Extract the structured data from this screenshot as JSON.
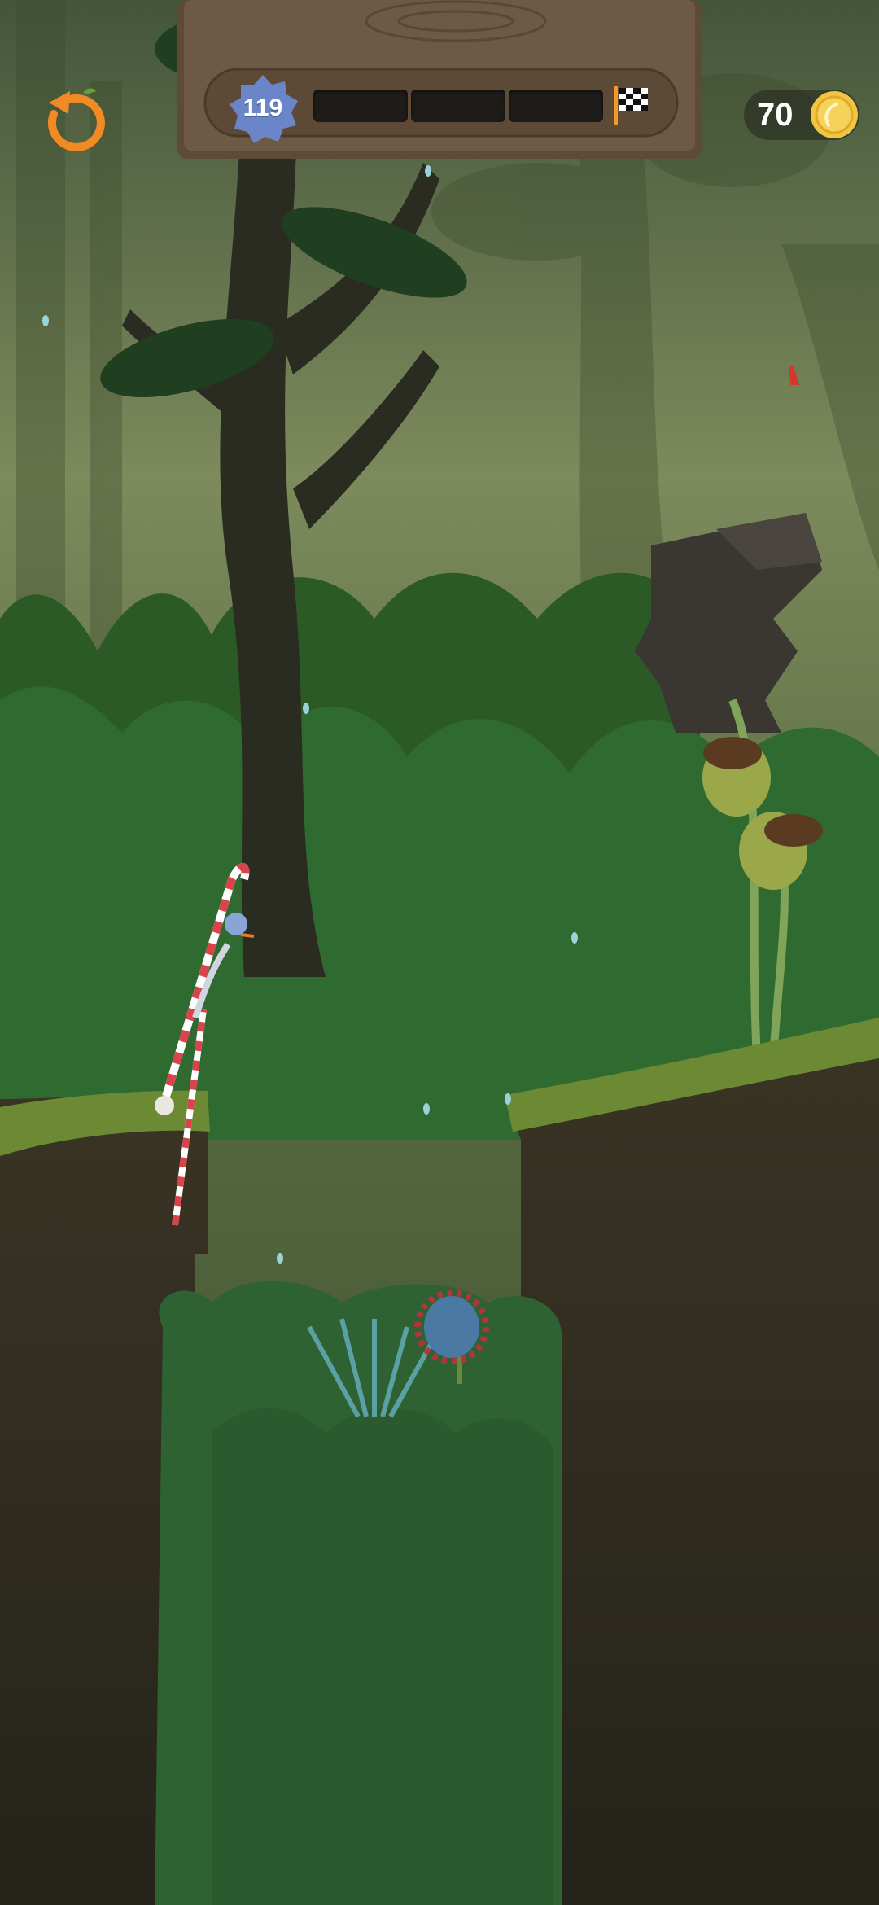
{
  "hud": {
    "restart_icon": "restart-arrow-icon",
    "level": "119",
    "level_badge_color": "#6a86c9",
    "progress": {
      "segments_total": 3,
      "segments_filled": 0
    },
    "finish_icon": "checkered-flag-icon",
    "coins": "70",
    "coin_icon": "gold-coin-icon"
  },
  "palette": {
    "sky": "#7c8a5c",
    "foliage_dark": "#1f4a24",
    "foliage_mid": "#2f6a30",
    "ground_top": "#6c8a34",
    "soil": "#2e2a1e",
    "candy_red": "#d9434a"
  }
}
